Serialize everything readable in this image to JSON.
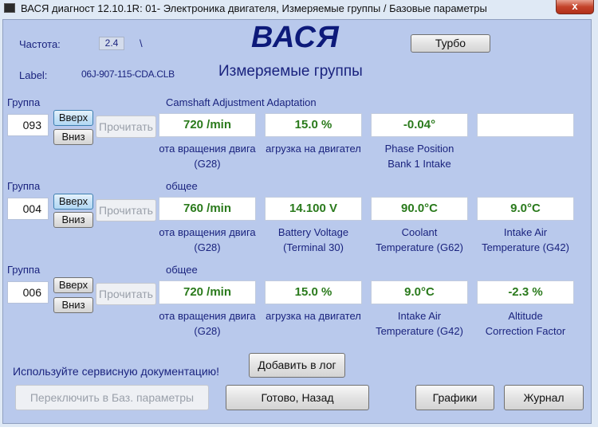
{
  "window": {
    "title": "ВАСЯ диагност 12.10.1R: 01- Электроника двигателя,  Измеряемые группы / Базовые параметры",
    "close_label": "x"
  },
  "header": {
    "freq_label": "Частота:",
    "freq_value": "2.4",
    "freq_indicator": "\\",
    "label_label": "Label:",
    "label_value": "06J-907-115-CDA.CLB",
    "logo": "ВАСЯ",
    "subtitle": "Измеряемые группы",
    "turbo_button": "Турбо"
  },
  "groups": [
    {
      "label": "Группа",
      "number": "093",
      "up": "Вверх",
      "down": "Вниз",
      "read": "Прочитать",
      "title": "Camshaft Adjustment Adaptation",
      "fields": [
        {
          "value": "720 /min",
          "desc1": "ота вращения двига",
          "desc2": "(G28)"
        },
        {
          "value": "15.0 %",
          "desc1": "агрузка на двигател",
          "desc2": ""
        },
        {
          "value": "-0.04°",
          "desc1": "Phase Position",
          "desc2": "Bank 1 Intake"
        },
        {
          "value": "",
          "desc1": "",
          "desc2": ""
        }
      ]
    },
    {
      "label": "Группа",
      "number": "004",
      "up": "Вверх",
      "down": "Вниз",
      "read": "Прочитать",
      "title": "общее",
      "fields": [
        {
          "value": "760 /min",
          "desc1": "ота вращения двига",
          "desc2": "(G28)"
        },
        {
          "value": "14.100 V",
          "desc1": "Battery Voltage",
          "desc2": "(Terminal 30)"
        },
        {
          "value": "90.0°C",
          "desc1": "Coolant",
          "desc2": "Temperature (G62)"
        },
        {
          "value": "9.0°C",
          "desc1": "Intake Air",
          "desc2": "Temperature (G42)"
        }
      ]
    },
    {
      "label": "Группа",
      "number": "006",
      "up": "Вверх",
      "down": "Вниз",
      "read": "Прочитать",
      "title": "общее",
      "fields": [
        {
          "value": "720 /min",
          "desc1": "ота вращения двига",
          "desc2": "(G28)"
        },
        {
          "value": "15.0 %",
          "desc1": "агрузка на двигател",
          "desc2": ""
        },
        {
          "value": "9.0°C",
          "desc1": "Intake Air",
          "desc2": "Temperature (G42)"
        },
        {
          "value": "-2.3 %",
          "desc1": "Altitude",
          "desc2": "Correction Factor"
        }
      ]
    }
  ],
  "footer": {
    "notice": "Используйте сервисную документацию!",
    "add_log": "Добавить в лог",
    "switch_basic": "Переключить в Баз. параметры",
    "done_back": "Готово, Назад",
    "graphs": "Графики",
    "journal": "Журнал"
  }
}
